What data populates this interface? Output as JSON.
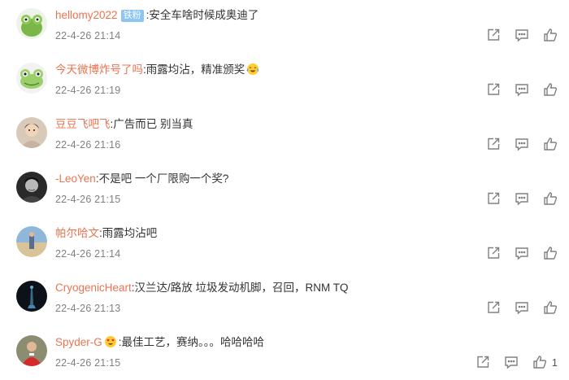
{
  "comments": [
    {
      "user": "hellomy2022",
      "badge": "铁粉",
      "text": ":安全车啥时候成奥迪了",
      "time": "22-4-26 21:14",
      "avatar": "frog-green"
    },
    {
      "user": "今天微博炸号了吗",
      "text": ":雨露均沾，精准颁奖",
      "emoji": "laughing-crying-emoji",
      "time": "22-4-26 21:19",
      "avatar": "frog-cartoon"
    },
    {
      "user": "豆豆飞吧飞",
      "text": ":广告而已 别当真",
      "time": "22-4-26 21:16",
      "avatar": "child-photo"
    },
    {
      "user": "-LeoYen",
      "text": ":不是吧 一个厂限购一个奖?",
      "time": "22-4-26 21:15",
      "avatar": "man-bw-photo"
    },
    {
      "user": "帕尔哈文",
      "text": ":雨露均沾吧",
      "time": "22-4-26 21:14",
      "avatar": "person-beach-photo"
    },
    {
      "user": "CryogenicHeart",
      "text": ":汉兰达/路放 垃圾发动机脚，召回，RNM TQ",
      "time": "22-4-26 21:13",
      "avatar": "tower-dark-photo"
    },
    {
      "user": "Spyder-G",
      "text": ":最佳工艺，赛纳。。。哈哈哈哈",
      "emoji": "heart-eyes-emoji",
      "time": "22-4-26 21:15",
      "avatar": "red-jersey-photo",
      "like_count": "1"
    }
  ],
  "icons": {
    "share": "share-icon",
    "comment": "comment-icon",
    "like": "thumbs-up-icon"
  },
  "colors": {
    "username": "#eb7350",
    "badge": "#8cc4f3",
    "time": "#808080",
    "icon": "#808080"
  }
}
